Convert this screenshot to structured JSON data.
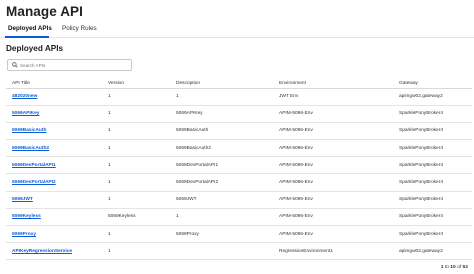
{
  "page": {
    "title": "Manage API"
  },
  "tabs": [
    {
      "label": "Deployed APIs",
      "active": true
    },
    {
      "label": "Policy Rules",
      "active": false
    }
  ],
  "section": {
    "title": "Deployed APIs"
  },
  "search": {
    "placeholder": "Search APIs",
    "value": ""
  },
  "table": {
    "columns": [
      "API Title",
      "Version",
      "Description",
      "Environment",
      "Gateway"
    ],
    "rows": [
      {
        "title": "482020new",
        "version": "1",
        "description": "1",
        "environment": "JWT Env",
        "gateway": "apimgw02.gateway2"
      },
      {
        "title": "5069APIKey",
        "version": "1",
        "description": "5069APIKey",
        "environment": "APIM-5096-Env",
        "gateway": "SparklePonyBroker4"
      },
      {
        "title": "5069BasicAuth",
        "version": "1",
        "description": "5069BasicAuth",
        "environment": "APIM-5096-Env",
        "gateway": "SparklePonyBroker4"
      },
      {
        "title": "5069BasicAuth2",
        "version": "1",
        "description": "5069BasicAuth2",
        "environment": "APIM-5096-Env",
        "gateway": "SparklePonyBroker4"
      },
      {
        "title": "5069DevPortalAPI1",
        "version": "1",
        "description": "5069DevPortalAPI1",
        "environment": "APIM-5096-Env",
        "gateway": "SparklePonyBroker4"
      },
      {
        "title": "5069DevPortalAPI2",
        "version": "1",
        "description": "5069DevPortalAPI2",
        "environment": "APIM-5096-Env",
        "gateway": "SparklePonyBroker4"
      },
      {
        "title": "5069JWT",
        "version": "1",
        "description": "5069JWT",
        "environment": "APIM-5096-Env",
        "gateway": "SparklePonyBroker4"
      },
      {
        "title": "5069Keyless",
        "version": "5069Keyless",
        "description": "1",
        "environment": "APIM-5096-Env",
        "gateway": "SparklePonyBroker4"
      },
      {
        "title": "5069Proxy",
        "version": "1",
        "description": "5069Proxy",
        "environment": "APIM-5096-Env",
        "gateway": "SparklePonyBroker4"
      },
      {
        "title": "APIKeyRegressionService",
        "version": "1",
        "description": "",
        "environment": "RegressionEnvironment1",
        "gateway": "apimgw02.gateway2"
      }
    ]
  },
  "pagination": {
    "start": "1",
    "to_word": "to",
    "end": "10",
    "of_word": "of",
    "total": "52"
  },
  "colors": {
    "link": "#0b5cd5",
    "tab_indicator": "#0b5cd5"
  }
}
